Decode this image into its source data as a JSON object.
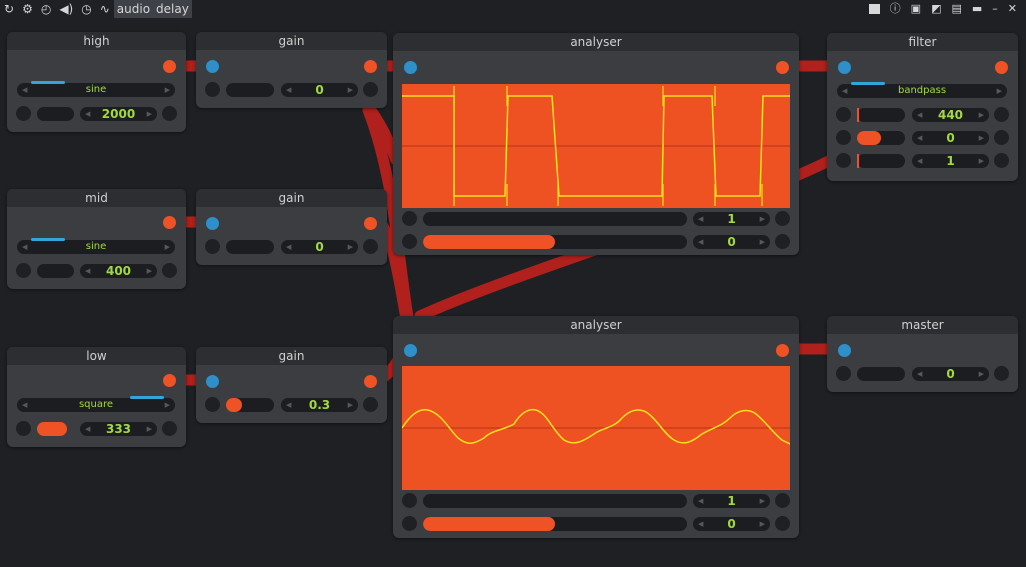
{
  "toolbar": {
    "menu_audio": "audio",
    "menu_delay": "delay",
    "icons": [
      "refresh-icon",
      "gear-icon",
      "gauge-icon",
      "speaker-icon",
      "clock-icon",
      "pulse-icon"
    ],
    "right_icons": [
      "terminal-icon",
      "info-icon",
      "copy-icon",
      "edit-icon",
      "document-icon",
      "folder-icon",
      "minimize-icon",
      "close-icon"
    ]
  },
  "nodes": {
    "high": {
      "title": "high",
      "waveform": "sine",
      "frequency": "2000"
    },
    "mid": {
      "title": "mid",
      "waveform": "sine",
      "frequency": "400"
    },
    "low": {
      "title": "low",
      "waveform": "square",
      "frequency": "333"
    },
    "gain_high": {
      "title": "gain",
      "value": "0"
    },
    "gain_mid": {
      "title": "gain",
      "value": "0"
    },
    "gain_low": {
      "title": "gain",
      "value": "0.3",
      "level": 0.3
    },
    "analyser_top": {
      "title": "analyser",
      "value1": "1",
      "value2": "0",
      "bar_fraction": 0.5
    },
    "analyser_bottom": {
      "title": "analyser",
      "value1": "1",
      "value2": "0",
      "bar_fraction": 0.5
    },
    "filter": {
      "title": "filter",
      "type": "bandpass",
      "frequency": "440",
      "gain": "0",
      "q": "1"
    },
    "master": {
      "title": "master",
      "value": "0"
    }
  },
  "colors": {
    "background": "#1e2024",
    "node": "#3b3d41",
    "accent_orange": "#ef5224",
    "input_blue": "#2e8fc9",
    "value_green": "#a2d93f",
    "wire_red": "#b0201c",
    "trace_yellow": "#f5e21a"
  }
}
